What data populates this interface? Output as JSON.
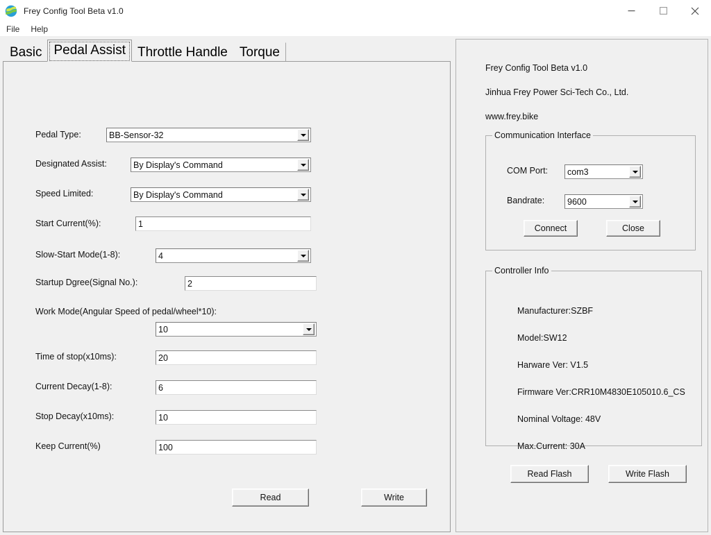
{
  "window": {
    "title": "Frey Config Tool Beta v1.0",
    "icon": "app-logo-icon",
    "minimize": "minimize-icon",
    "maximize": "maximize-icon",
    "close": "close-icon"
  },
  "menubar": {
    "items": [
      {
        "label": "File"
      },
      {
        "label": "Help"
      }
    ]
  },
  "tabs": [
    {
      "label": "Basic",
      "selected": false
    },
    {
      "label": "Pedal Assist",
      "selected": true
    },
    {
      "label": "Throttle Handle",
      "selected": false
    },
    {
      "label": "Torque",
      "selected": false
    }
  ],
  "pedal_assist": {
    "fields": [
      {
        "label": "Pedal Type:",
        "type": "combo",
        "value": "BB-Sensor-32"
      },
      {
        "label": "Designated Assist:",
        "type": "combo",
        "value": "By Display's Command"
      },
      {
        "label": "Speed Limited:",
        "type": "combo",
        "value": "By Display's Command"
      },
      {
        "label": "Start Current(%):",
        "type": "text",
        "value": "1"
      },
      {
        "label": "Slow-Start Mode(1-8):",
        "type": "combo",
        "value": "4"
      },
      {
        "label": "Startup Dgree(Signal No.):",
        "type": "text",
        "value": "2"
      },
      {
        "label": "Work Mode(Angular Speed of pedal/wheel*10):",
        "type": "combo",
        "value": "10"
      },
      {
        "label": "Time of stop(x10ms):",
        "type": "text",
        "value": "20"
      },
      {
        "label": "Current Decay(1-8):",
        "type": "text",
        "value": "6"
      },
      {
        "label": "Stop Decay(x10ms):",
        "type": "text",
        "value": "10"
      },
      {
        "label": "Keep Current(%)",
        "type": "text",
        "value": "100"
      }
    ],
    "read_button": "Read",
    "write_button": "Write"
  },
  "sidebar": {
    "brand": [
      "Frey Config Tool Beta v1.0",
      "Jinhua Frey Power Sci-Tech Co., Ltd.",
      "www.frey.bike"
    ],
    "communication": {
      "title": "Communication Interface",
      "com_port_label": "COM Port:",
      "com_port_value": "com3",
      "bandrate_label": "Bandrate:",
      "bandrate_value": "9600",
      "connect_button": "Connect",
      "close_button": "Close"
    },
    "controller_info": {
      "title": "Controller Info",
      "lines": [
        "Manufacturer:SZBF",
        "Model:SW12",
        "Harware Ver: V1.5",
        "Firmware Ver:CRR10M4830E105010.6_CS",
        "Nominal Voltage: 48V",
        "Max.Current: 30A"
      ]
    },
    "read_flash_button": "Read Flash",
    "write_flash_button": "Write Flash"
  }
}
